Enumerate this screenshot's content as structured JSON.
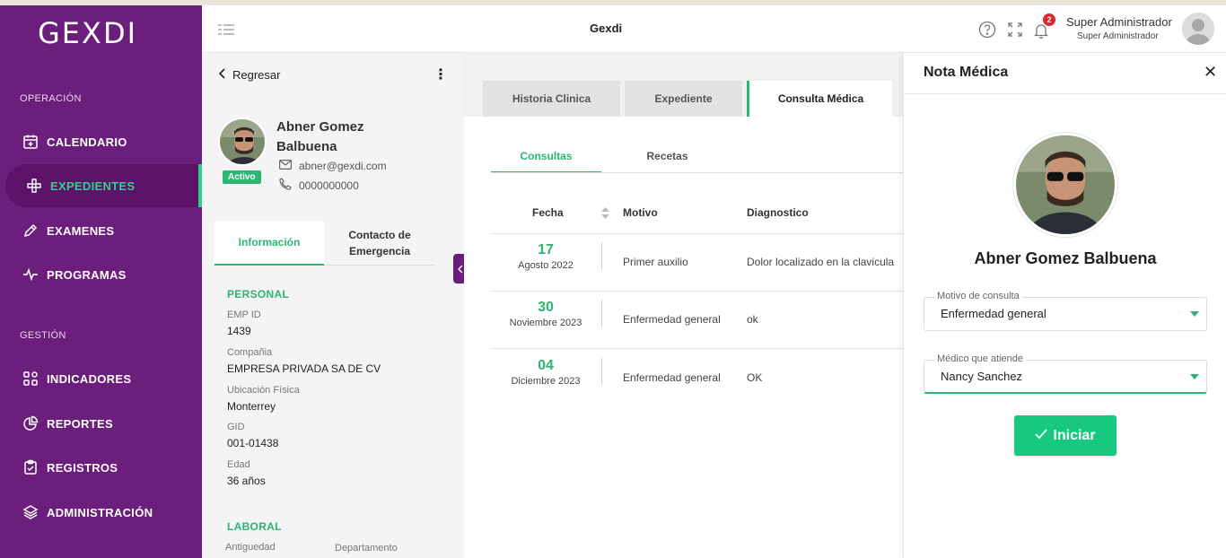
{
  "app": {
    "logo": "GEXDI",
    "title": "Gexdi"
  },
  "header": {
    "notification_count": "2",
    "user_name": "Super Administrador",
    "user_role": "Super Administrador"
  },
  "sidebar": {
    "sections": [
      {
        "title": "OPERACIÓN"
      },
      {
        "title": "GESTIÓN"
      }
    ],
    "items": [
      {
        "label": "CALENDARIO",
        "icon": "calendar-icon"
      },
      {
        "label": "EXPEDIENTES",
        "icon": "medical-cross-icon"
      },
      {
        "label": "EXAMENES",
        "icon": "pen-icon"
      },
      {
        "label": "PROGRAMAS",
        "icon": "pulse-icon"
      },
      {
        "label": "INDICADORES",
        "icon": "grid-icon"
      },
      {
        "label": "REPORTES",
        "icon": "pie-chart-icon"
      },
      {
        "label": "REGISTROS",
        "icon": "clipboard-icon"
      },
      {
        "label": "ADMINISTRACIÓN",
        "icon": "layers-icon"
      }
    ],
    "active_item": "EXPEDIENTES",
    "colors": {
      "background": "#6b1e7b",
      "accent": "#2fd08a"
    }
  },
  "patient": {
    "back_label": "Regresar",
    "name": "Abner Gomez Balbuena",
    "status": "Activo",
    "email": "abner@gexdi.com",
    "phone": "0000000000",
    "tabs": [
      "Información",
      "Contacto de Emergencia"
    ],
    "personal_title": "PERSONAL",
    "fields": [
      {
        "label": "EMP ID",
        "value": "1439"
      },
      {
        "label": "Compañia",
        "value": "EMPRESA PRIVADA SA DE CV"
      },
      {
        "label": "Ubicación Física",
        "value": "Monterrey"
      },
      {
        "label": "GID",
        "value": "001-01438"
      },
      {
        "label": "Edad",
        "value": "36 años"
      }
    ],
    "laboral_title": "LABORAL",
    "laboral_fields": [
      {
        "label": "Antiguedad"
      },
      {
        "label": "Departamento"
      }
    ]
  },
  "main": {
    "tabs": [
      "Historia Clinica",
      "Expediente",
      "Consulta Médica"
    ],
    "active_tab": "Consulta Médica",
    "subtabs": [
      "Consultas",
      "Recetas"
    ],
    "active_subtab": "Consultas",
    "table": {
      "headers": [
        "Fecha",
        "Motivo",
        "Diagnostico"
      ],
      "rows": [
        {
          "day": "17",
          "month_year": "Agosto 2022",
          "motivo": "Primer auxilio",
          "diagnostico": "Dolor localizado en la clavicula"
        },
        {
          "day": "30",
          "month_year": "Noviembre 2023",
          "motivo": "Enfermedad general",
          "diagnostico": "ok"
        },
        {
          "day": "04",
          "month_year": "Diciembre 2023",
          "motivo": "Enfermedad general",
          "diagnostico": "OK"
        }
      ]
    }
  },
  "drawer": {
    "title": "Nota Médica",
    "patient_name": "Abner Gomez Balbuena",
    "motivo_label": "Motivo de consulta",
    "motivo_value": "Enfermedad general",
    "medico_label": "Médico que atiende",
    "medico_value": "Nancy Sanchez",
    "start_label": "Iniciar",
    "colors": {
      "button": "#17c97f"
    }
  }
}
